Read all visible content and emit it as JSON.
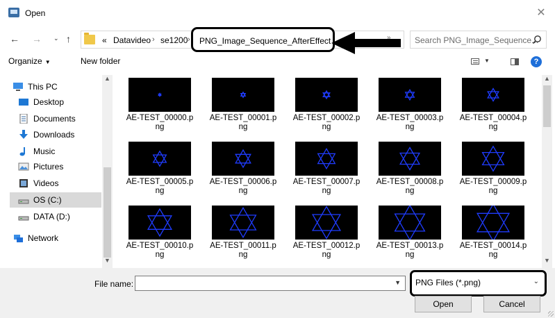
{
  "window": {
    "title": "Open"
  },
  "nav": {
    "breadcrumb": [
      {
        "label": "«"
      },
      {
        "label": "Datavideo"
      },
      {
        "label": "se1200"
      },
      {
        "label": "PNG_Image_Sequence_AfterEffect"
      }
    ],
    "separator": "›",
    "search_placeholder": "Search PNG_Image_Sequence..."
  },
  "toolbar": {
    "organize": "Organize",
    "new_folder": "New folder"
  },
  "sidebar": {
    "items": [
      {
        "label": "This PC",
        "icon": "computer-icon"
      },
      {
        "label": "Desktop",
        "icon": "desktop-icon"
      },
      {
        "label": "Documents",
        "icon": "documents-icon"
      },
      {
        "label": "Downloads",
        "icon": "downloads-icon"
      },
      {
        "label": "Music",
        "icon": "music-icon"
      },
      {
        "label": "Pictures",
        "icon": "pictures-icon"
      },
      {
        "label": "Videos",
        "icon": "videos-icon"
      },
      {
        "label": "OS (C:)",
        "icon": "drive-icon",
        "selected": true
      },
      {
        "label": "DATA (D:)",
        "icon": "drive-icon"
      },
      {
        "label": "Network",
        "icon": "network-icon"
      }
    ]
  },
  "files": [
    {
      "name": "AE-TEST_00000.p\nng"
    },
    {
      "name": "AE-TEST_00001.p\nng"
    },
    {
      "name": "AE-TEST_00002.p\nng"
    },
    {
      "name": "AE-TEST_00003.p\nng"
    },
    {
      "name": "AE-TEST_00004.p\nng"
    },
    {
      "name": "AE-TEST_00005.p\nng"
    },
    {
      "name": "AE-TEST_00006.p\nng"
    },
    {
      "name": "AE-TEST_00007.p\nng"
    },
    {
      "name": "AE-TEST_00008.p\nng"
    },
    {
      "name": "AE-TEST_00009.p\nng"
    },
    {
      "name": "AE-TEST_00010.p\nng"
    },
    {
      "name": "AE-TEST_00011.p\nng"
    },
    {
      "name": "AE-TEST_00012.p\nng"
    },
    {
      "name": "AE-TEST_00013.p\nng"
    },
    {
      "name": "AE-TEST_00014.p\nng"
    }
  ],
  "footer": {
    "file_name_label": "File name:",
    "file_name_value": "",
    "file_type": "PNG Files (*.png)",
    "open_button": "Open",
    "cancel_button": "Cancel"
  },
  "colors": {
    "accent": "#1e6fd9",
    "star": "#1f3cff",
    "thumb_bg": "#000000"
  }
}
